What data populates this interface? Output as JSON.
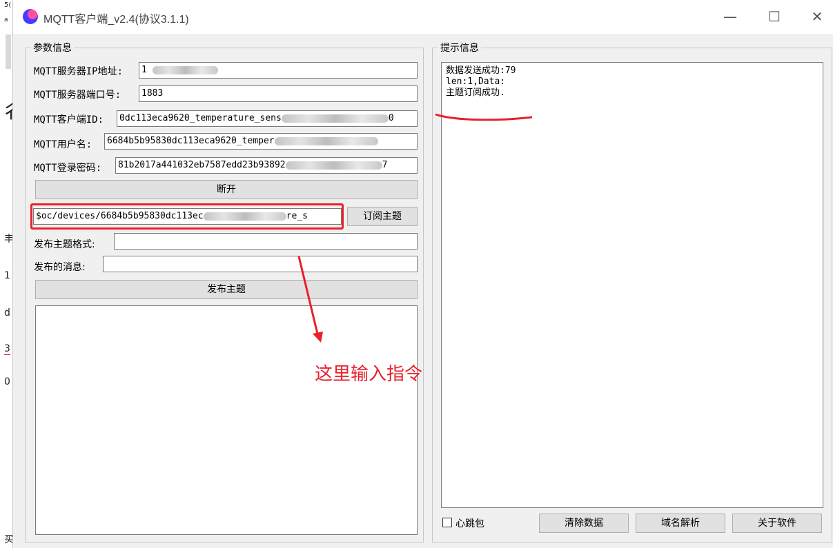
{
  "window": {
    "title": "MQTT客户端_v2.4(协议3.1.1)",
    "minimize_icon": "—",
    "maximize_icon": "☐",
    "close_icon": "✕"
  },
  "params": {
    "legend": "参数信息",
    "ip_label": "MQTT服务器IP地址:",
    "ip_value": "1",
    "port_label": "MQTT服务器端口号:",
    "port_value": "1883",
    "client_id_label": "MQTT客户端ID:",
    "client_id_value": "0dc113eca9620_temperature_sens",
    "client_id_tail": "0",
    "username_label": "MQTT用户名:",
    "username_value": "6684b5b95830dc113eca9620_temper",
    "password_label": "MQTT登录密码:",
    "password_value": "81b2017a441032eb7587edd23b93892",
    "password_tail": "7",
    "disconnect_button": "断开",
    "subscribe_topic_value": "$oc/devices/6684b5b95830dc113ec",
    "subscribe_topic_tail": "re_s",
    "subscribe_button": "订阅主题",
    "publish_format_label": "发布主题格式:",
    "publish_format_value": "",
    "publish_message_label": "发布的消息:",
    "publish_message_value": "",
    "publish_button": "发布主题"
  },
  "info": {
    "legend": "提示信息",
    "log_lines": [
      "数据发送成功:79",
      "len:1,Data:",
      "主题订阅成功."
    ],
    "heartbeat_label": "心跳包",
    "heartbeat_checked": false,
    "clear_button": "清除数据",
    "dns_button": "域名解析",
    "about_button": "关于软件"
  },
  "annotation": {
    "text": "这里输入指令",
    "color": "#e8202a"
  },
  "background_window": {
    "fragments": [
      "5(",
      "a",
      "1",
      "e",
      "d",
      "3",
      "0",
      "买"
    ]
  }
}
